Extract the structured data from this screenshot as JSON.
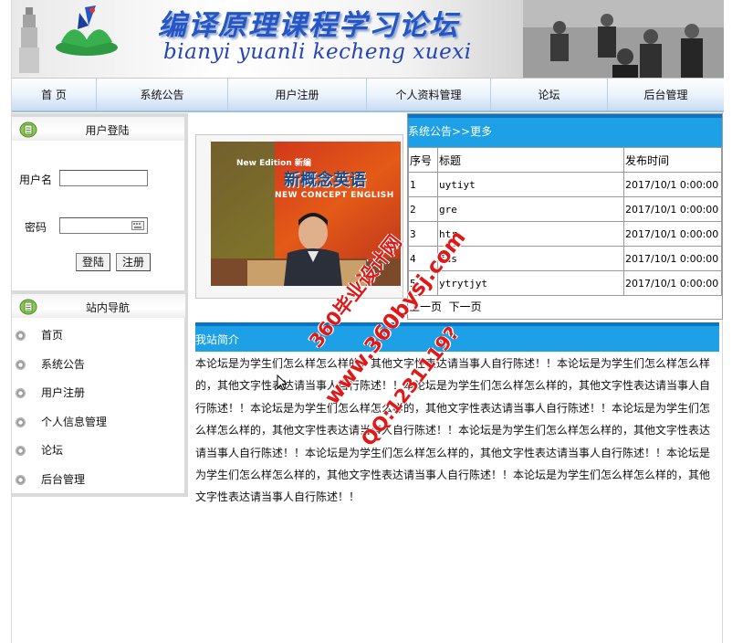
{
  "header": {
    "title_cn": "编译原理课程学习论坛",
    "title_en": "bianyi yuanli kecheng xuexi"
  },
  "nav": {
    "items": [
      "首 页",
      "系统公告",
      "用户注册",
      "个人资料管理",
      "论坛",
      "后台管理"
    ]
  },
  "login": {
    "title": "用户登陆",
    "username_label": "用户名",
    "password_label": "密码",
    "username_value": "",
    "password_value": "",
    "login_button": "登陆",
    "register_button": "注册"
  },
  "site_nav": {
    "title": "站内导航",
    "items": [
      "首页",
      "系统公告",
      "用户注册",
      "个人信息管理",
      "论坛",
      "后台管理"
    ]
  },
  "video": {
    "badge": "New Edition 新编",
    "title_cn": "新概念英语",
    "title_en": "NEW CONCEPT ENGLISH"
  },
  "notice": {
    "header": "系统公告>>更多",
    "columns": [
      "序号",
      "标题",
      "发布时间"
    ],
    "rows": [
      {
        "no": "1",
        "title": "uytiyt",
        "time": "2017/10/1 0:00:00"
      },
      {
        "no": "2",
        "title": "gre",
        "time": "2017/10/1 0:00:00"
      },
      {
        "no": "3",
        "title": "htr",
        "time": "2017/10/1 0:00:00"
      },
      {
        "no": "4",
        "title": "fds",
        "time": "2017/10/1 0:00:00"
      },
      {
        "no": "5",
        "title": "ytrytjyt",
        "time": "2017/10/1 0:00:00"
      }
    ],
    "prev_page": "上一页",
    "next_page": "下一页"
  },
  "intro": {
    "header": "我站简介",
    "text": "本论坛是为学生们怎么样怎么样的，其他文字性表达请当事人自行陈述！！本论坛是为学生们怎么样怎么样的，其他文字性表达请当事人自行陈述！！本论坛是为学生们怎么样怎么样的，其他文字性表达请当事人自行陈述！！本论坛是为学生们怎么样怎么样的，其他文字性表达请当事人自行陈述！！本论坛是为学生们怎么样怎么样的，其他文字性表达请当事人自行陈述！！本论坛是为学生们怎么样怎么样的，其他文字性表达请当事人自行陈述！！本论坛是为学生们怎么样怎么样的，其他文字性表达请当事人自行陈述！！本论坛是为学生们怎么样怎么样的，其他文字性表达请当事人自行陈述！！本论坛是为学生们怎么样怎么样的，其他文字性表达请当事人自行陈述！！"
  },
  "watermark": {
    "line1": "360毕业设计网",
    "line2": "www.360bysj.com",
    "line3": "QQ:1231119?"
  },
  "colors": {
    "accent_blue": "#1ea0e6",
    "title_blue": "#2456c8",
    "watermark_red": "#e01818"
  }
}
